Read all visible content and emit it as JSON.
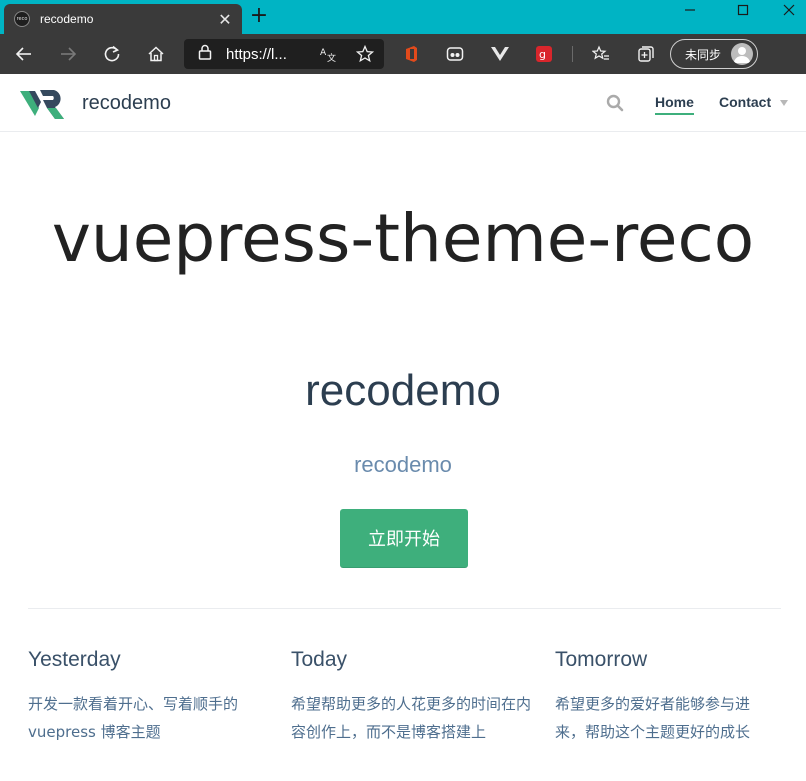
{
  "browser": {
    "tab_title": "recodemo",
    "favicon_text": "reco",
    "new_tab": "+",
    "address_text": "https://l...",
    "sync_label": "未同步",
    "icons": [
      "back-icon",
      "forward-icon",
      "refresh-icon",
      "home-icon",
      "lock-icon",
      "translate-icon",
      "favorite-star-icon",
      "office-extension-icon",
      "extension-icon",
      "vuejs-devtools-icon",
      "extension-red-icon",
      "favorites-icon",
      "collections-icon"
    ]
  },
  "navbar": {
    "site_name": "recodemo",
    "links": [
      {
        "label": "Home",
        "active": true
      },
      {
        "label": "Contact",
        "has_dropdown": true
      }
    ],
    "accent_color": "#3eaf7c"
  },
  "hero": {
    "big_text": "vuepress-theme-reco",
    "title": "recodemo",
    "description": "recodemo",
    "action_label": "立即开始"
  },
  "features": [
    {
      "title": "Yesterday",
      "details": "开发一款看着开心、写着顺手的 vuepress 博客主题"
    },
    {
      "title": "Today",
      "details": "希望帮助更多的人花更多的时间在内容创作上，而不是博客搭建上"
    },
    {
      "title": "Tomorrow",
      "details": "希望更多的爱好者能够参与进来，帮助这个主题更好的成长"
    }
  ]
}
